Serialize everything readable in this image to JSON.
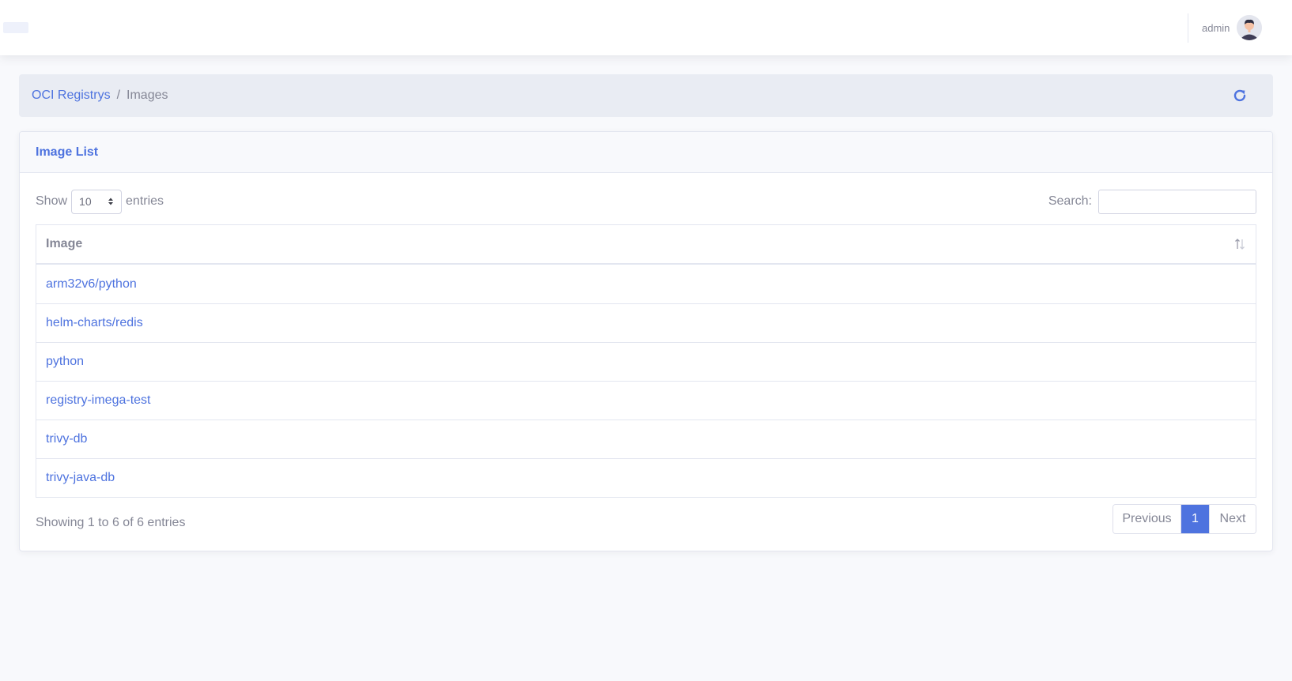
{
  "header": {
    "user_name": "admin"
  },
  "breadcrumb": {
    "root_label": "OCI Registrys",
    "separator": "/",
    "current_label": "Images"
  },
  "card": {
    "title": "Image List"
  },
  "controls": {
    "show_label": "Show",
    "page_length": "10",
    "entries_label": "entries",
    "search_label": "Search:",
    "search_value": ""
  },
  "table": {
    "column_header": "Image",
    "rows": [
      "arm32v6/python",
      "helm-charts/redis",
      "python",
      "registry-imega-test",
      "trivy-db",
      "trivy-java-db"
    ]
  },
  "footer": {
    "info_text": "Showing 1 to 6 of 6 entries",
    "prev_label": "Previous",
    "current_page": "1",
    "next_label": "Next"
  },
  "colors": {
    "primary": "#4e73df",
    "text_muted": "#858796",
    "background": "#f8f9fc"
  },
  "icons": {
    "refresh": "refresh-icon",
    "sort": "sort-icon",
    "avatar": "user-avatar",
    "select_caret": "select-caret-icon"
  }
}
